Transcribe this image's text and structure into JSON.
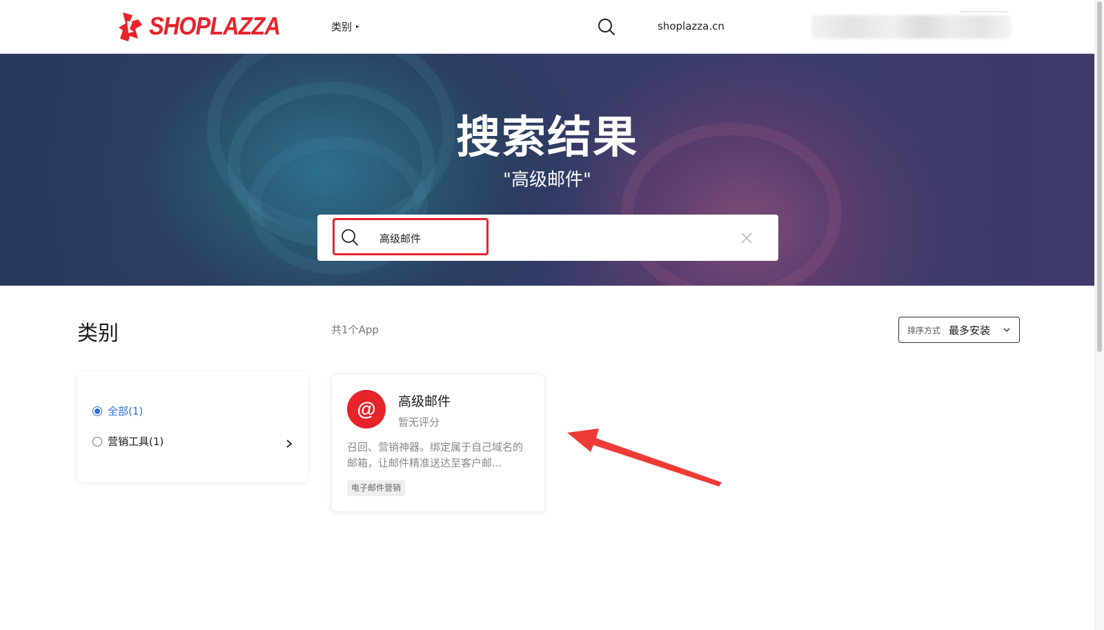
{
  "header": {
    "logo_text": "SHOPLAZZA",
    "nav_category": "类别",
    "domain": "shoplazza.cn"
  },
  "hero": {
    "title": "搜索结果",
    "subtitle": "\"高级邮件\"",
    "search_value": "高级邮件"
  },
  "sidebar": {
    "heading": "类别",
    "items": [
      {
        "label": "全部(1)",
        "selected": true
      },
      {
        "label": "营销工具(1)",
        "selected": false
      }
    ]
  },
  "results": {
    "count": "共1个App",
    "sort_label": "排序方式",
    "sort_value": "最多安装",
    "apps": [
      {
        "icon_glyph": "@",
        "name": "高级邮件",
        "rating": "暂无评分",
        "description": "召回、营销神器。绑定属于自己域名的邮箱，让邮件精准送达至客户邮...",
        "tag": "电子邮件营销"
      }
    ]
  },
  "colors": {
    "brand_red": "#e8232a",
    "accent_blue": "#2d6fdb",
    "annotation_red": "#ef3b36"
  },
  "icons": {
    "logo": "shoplazza-logo-icon",
    "nav_search": "search-icon",
    "search_clear": "close-icon",
    "sort": "chevron-down-icon",
    "category_expand": "chevron-right-icon",
    "annotation": "arrow-annotation-icon"
  }
}
